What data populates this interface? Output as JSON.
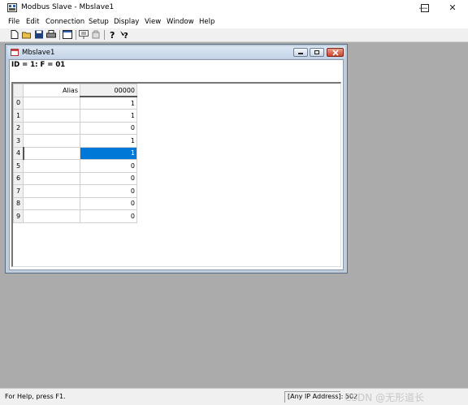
{
  "app": {
    "title": "Modbus Slave - Mbslave1"
  },
  "menu": [
    "File",
    "Edit",
    "Connection",
    "Setup",
    "Display",
    "View",
    "Window",
    "Help"
  ],
  "toolbar": {
    "icons": [
      "new-icon",
      "open-icon",
      "save-icon",
      "print-icon",
      "window-icon",
      "read-icon",
      "write-icon",
      "help-icon",
      "context-help-icon"
    ]
  },
  "child": {
    "title": "Mbslave1",
    "id_line": "ID = 1: F = 01",
    "grid": {
      "alias_header": "Alias",
      "address_header": "00000",
      "rows": [
        {
          "index": "0",
          "alias": "",
          "value": "1"
        },
        {
          "index": "1",
          "alias": "",
          "value": "1"
        },
        {
          "index": "2",
          "alias": "",
          "value": "0"
        },
        {
          "index": "3",
          "alias": "",
          "value": "1"
        },
        {
          "index": "4",
          "alias": "",
          "value": "1",
          "selected": true
        },
        {
          "index": "5",
          "alias": "",
          "value": "0"
        },
        {
          "index": "6",
          "alias": "",
          "value": "0"
        },
        {
          "index": "7",
          "alias": "",
          "value": "0"
        },
        {
          "index": "8",
          "alias": "",
          "value": "0"
        },
        {
          "index": "9",
          "alias": "",
          "value": "0"
        }
      ]
    }
  },
  "statusbar": {
    "help": "For Help, press F1.",
    "connection": "[Any IP Address]: 502",
    "watermark": "CSDN @无形道长"
  },
  "colors": {
    "selection": "#0078d7",
    "mdi_background": "#ababab"
  }
}
